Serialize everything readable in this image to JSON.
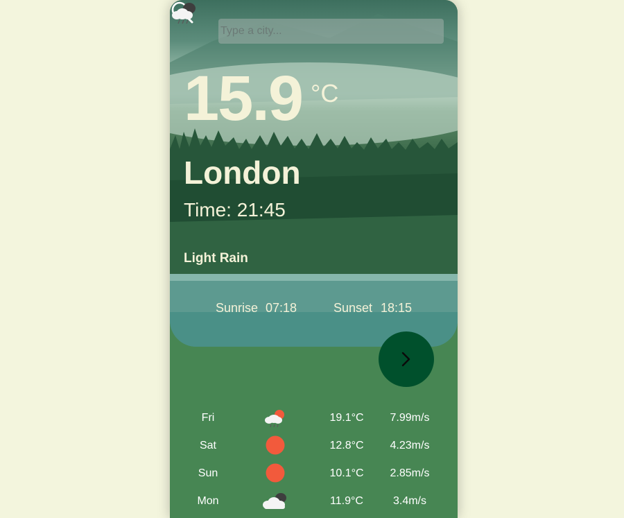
{
  "search": {
    "placeholder": "Type a city..."
  },
  "current": {
    "temperature": "15.9",
    "unit": "°C",
    "city": "London",
    "time": "Time: 21:45",
    "condition": "Light Rain",
    "condition_icon": "cloud-rain-night-icon",
    "sunrise_label": "Sunrise",
    "sunrise_time": "07:18",
    "sunset_label": "Sunset",
    "sunset_time": "18:15"
  },
  "forecast": [
    {
      "day": "Fri",
      "icon": "sun-cloud-rain-icon",
      "temp": "19.1°C",
      "wind": "7.99m/s"
    },
    {
      "day": "Sat",
      "icon": "sun-icon",
      "temp": "12.8°C",
      "wind": "4.23m/s"
    },
    {
      "day": "Sun",
      "icon": "sun-icon",
      "temp": "10.1°C",
      "wind": "2.85m/s"
    },
    {
      "day": "Mon",
      "icon": "clouds-icon",
      "temp": "11.9°C",
      "wind": "3.4m/s"
    }
  ],
  "colors": {
    "background": "#f3f5dd",
    "card_green": "#478653",
    "button_green": "#00502c",
    "text_cream": "#f4f2d8",
    "sun_orange": "#f25a3c"
  }
}
